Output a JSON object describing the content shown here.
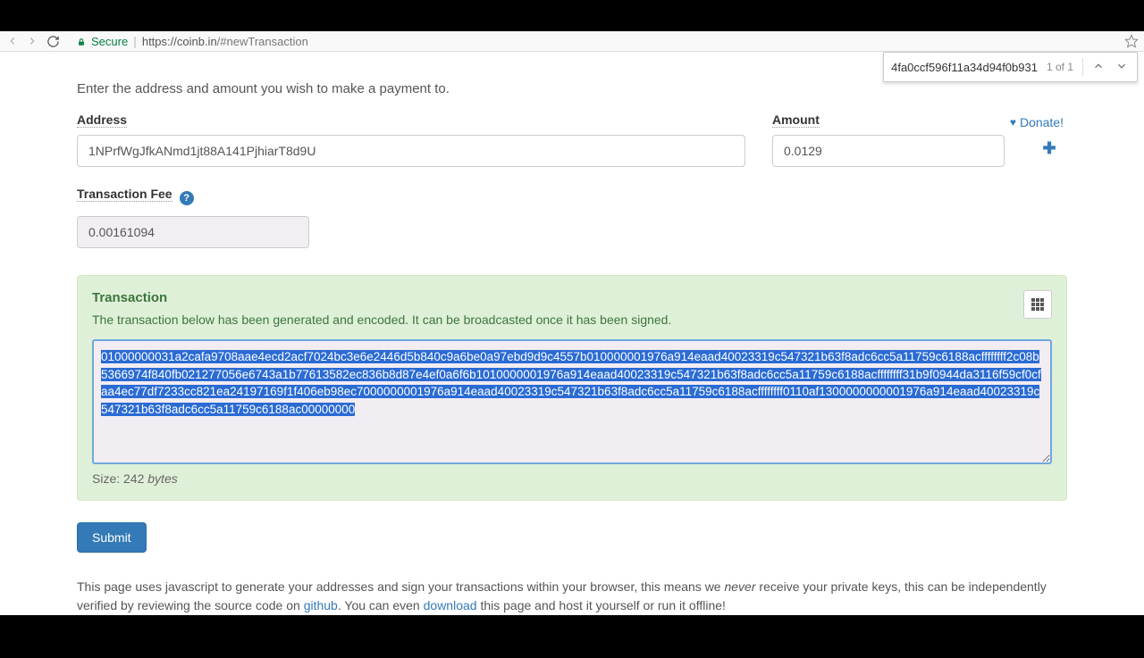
{
  "browser": {
    "secure_label": "Secure",
    "url_host": "https://coinb.in",
    "url_path": "/#newTransaction",
    "find": {
      "query": "4fa0ccf596f11a34d94f0b931",
      "position": "1 of 1"
    }
  },
  "donate": {
    "label": "Donate!"
  },
  "intro": "Enter the address and amount you wish to make a payment to.",
  "address": {
    "label": "Address",
    "value": "1NPrfWgJfkANmd1jt88A141PjhiarT8d9U"
  },
  "amount": {
    "label": "Amount",
    "value": "0.0129"
  },
  "fee": {
    "label": "Transaction Fee",
    "value": "0.00161094"
  },
  "transaction": {
    "title": "Transaction",
    "desc": "The transaction below has been generated and encoded. It can be broadcasted once it has been signed.",
    "hex": "01000000031a2cafa9708aae4ecd2acf7024bc3e6e2446d5b840c9a6be0a97ebd9d9c4557b010000001976a914eaad40023319c547321b63f8adc6cc5a11759c6188acffffffff2c08b5366974f840fb021277056e6743a1b77613582ec836b8d87e4ef0a6f6b1010000001976a914eaad40023319c547321b63f8adc6cc5a11759c6188acffffffff31b9f0944da3116f59cf0cfaa4ec77df7233cc821ea24197169f1f406eb98ec7000000001976a914eaad40023319c547321b63f8adc6cc5a11759c6188acffffffff0110af1300000000001976a914eaad40023319c547321b63f8adc6cc5a11759c6188ac00000000",
    "size_prefix": "Size: ",
    "size_value": "242",
    "size_unit": "bytes"
  },
  "submit": {
    "label": "Submit"
  },
  "footer": {
    "t1": "This page uses javascript to generate your addresses and sign your transactions within your browser, this means we ",
    "never": "never",
    "t2": " receive your private keys, this can be independently verified by reviewing the source code on ",
    "github": "github",
    "t3": ". You can even ",
    "download": "download",
    "t4": " this page and host it yourself or run it offline!"
  }
}
